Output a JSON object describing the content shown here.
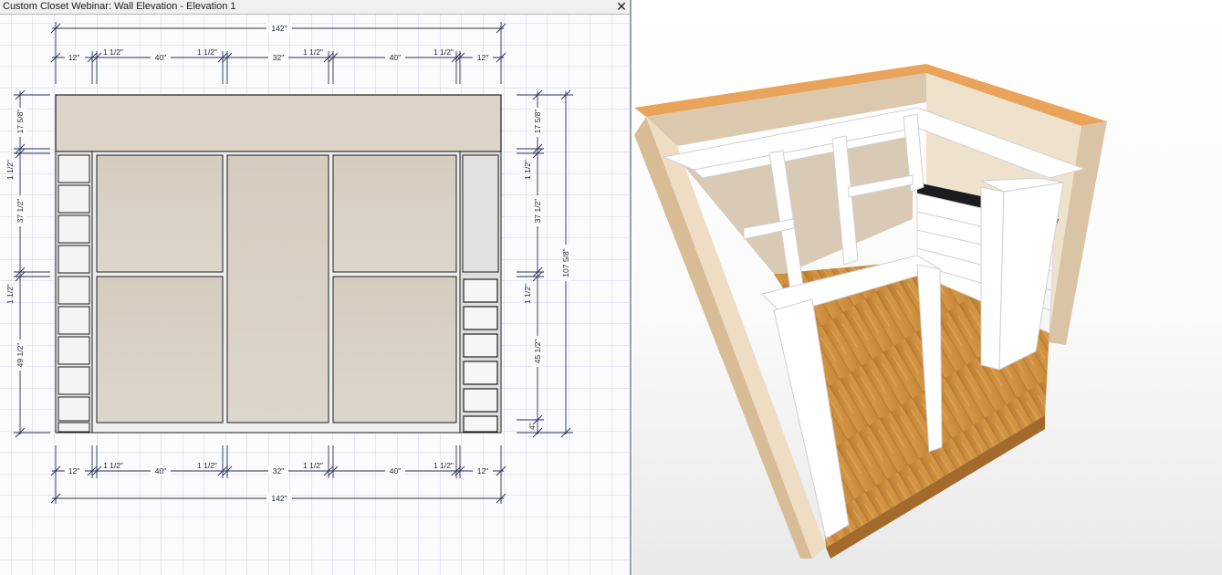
{
  "window": {
    "title": "Custom Closet Webinar: Wall Elevation - Elevation 1",
    "close_glyph": "✕"
  },
  "dimensions": {
    "top_overall": "142\"",
    "top_segments": [
      "12\"",
      "1 1/2\"",
      "40\"",
      "1 1/2\"",
      "32\"",
      "1 1/2\"",
      "40\"",
      "1 1/2\"",
      "12\""
    ],
    "bottom_overall": "142\"",
    "bottom_segments": [
      "12\"",
      "1 1/2\"",
      "40\"",
      "1 1/2\"",
      "32\"",
      "1 1/2\"",
      "40\"",
      "1 1/2\"",
      "12\""
    ],
    "left_segments": [
      "17 5/8\"",
      "1 1/2\"",
      "37 1/2\"",
      "1 1/2\"",
      "49 1/2\""
    ],
    "right_segments": [
      "17 5/8\"",
      "1 1/2\"",
      "37 1/2\"",
      "1 1/2\"",
      "45 1/2\"",
      "4\""
    ],
    "right_overall": "107 5/8\""
  },
  "colors": {
    "panel_fill": "#d7cfc3",
    "soffit_fill": "#dcd4c9",
    "grid_line": "#cfd3e6",
    "dim_line": "#2a2f55",
    "outline": "#1e1e1e",
    "wall_tan": "#ead8bd",
    "floor_wood": "#c98a3d",
    "cabinet_white": "#ffffff",
    "countertop": "#1c1c20"
  }
}
